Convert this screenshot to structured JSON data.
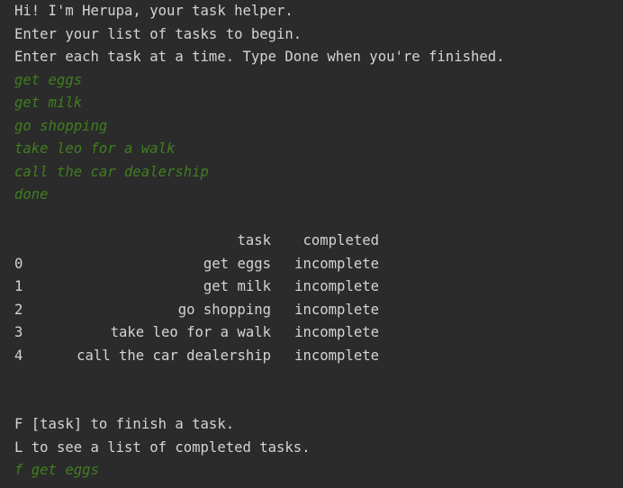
{
  "intro": [
    "Hi! I'm Herupa, your task helper.",
    "Enter your list of tasks to begin.",
    "Enter each task at a time. Type Done when you're finished."
  ],
  "user_inputs": [
    "get eggs",
    "get milk",
    "go shopping",
    "take leo for a walk",
    "call the car dealership",
    "done"
  ],
  "table": {
    "headers": [
      "",
      "task",
      "completed"
    ],
    "rows": [
      [
        "0",
        "get eggs",
        "incomplete"
      ],
      [
        "1",
        "get milk",
        "incomplete"
      ],
      [
        "2",
        "go shopping",
        "incomplete"
      ],
      [
        "3",
        "take leo for a walk",
        "incomplete"
      ],
      [
        "4",
        "call the car dealership",
        "incomplete"
      ]
    ]
  },
  "menu": [
    "F [task] to finish a task.",
    "L to see a list of completed tasks."
  ],
  "final_input": "f get eggs"
}
